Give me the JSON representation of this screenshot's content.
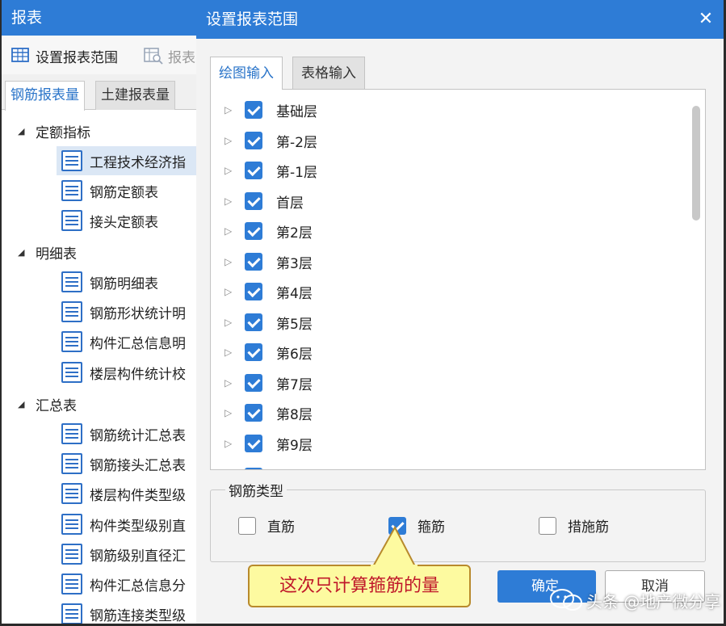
{
  "left_panel": {
    "title": "报表",
    "toolbar": {
      "set_range_label": "设置报表范围",
      "report_label": "报表"
    },
    "tabs": [
      {
        "label": "钢筋报表量",
        "active": true
      },
      {
        "label": "土建报表量",
        "active": false
      }
    ],
    "tree": {
      "groups": [
        {
          "label": "定额指标",
          "items": [
            "工程技术经济指",
            "钢筋定额表",
            "接头定额表"
          ]
        },
        {
          "label": "明细表",
          "items": [
            "钢筋明细表",
            "钢筋形状统计明",
            "构件汇总信息明",
            "楼层构件统计校"
          ]
        },
        {
          "label": "汇总表",
          "items": [
            "钢筋统计汇总表",
            "钢筋接头汇总表",
            "楼层构件类型级",
            "构件类型级别直",
            "钢筋级别直径汇",
            "构件汇总信息分",
            "钢筋连接类型级"
          ]
        }
      ],
      "selected_item": "工程技术经济指"
    }
  },
  "dialog": {
    "title": "设置报表范围",
    "close_icon": "close-icon",
    "tabs": [
      {
        "label": "绘图输入",
        "active": true
      },
      {
        "label": "表格输入",
        "active": false
      }
    ],
    "floors": [
      {
        "label": "基础层",
        "checked": true
      },
      {
        "label": "第-2层",
        "checked": true
      },
      {
        "label": "第-1层",
        "checked": true
      },
      {
        "label": "首层",
        "checked": true
      },
      {
        "label": "第2层",
        "checked": true
      },
      {
        "label": "第3层",
        "checked": true
      },
      {
        "label": "第4层",
        "checked": true
      },
      {
        "label": "第5层",
        "checked": true
      },
      {
        "label": "第6层",
        "checked": true
      },
      {
        "label": "第7层",
        "checked": true
      },
      {
        "label": "第8层",
        "checked": true
      },
      {
        "label": "第9层",
        "checked": true
      }
    ],
    "rebar_type": {
      "legend": "钢筋类型",
      "options": [
        {
          "label": "直筋",
          "checked": false
        },
        {
          "label": "箍筋",
          "checked": true
        },
        {
          "label": "措施筋",
          "checked": false
        }
      ]
    },
    "confirm_label": "确定",
    "cancel_label": "取消"
  },
  "callout": {
    "text": "这次只计算箍筋的量"
  },
  "watermark": {
    "text": "头条 @地产微分享"
  },
  "colors": {
    "title_bar": "#2e7cd6",
    "checkbox": "#2e7cd6",
    "callout_bg": "#fdfaa0",
    "callout_text": "#c0182a"
  }
}
